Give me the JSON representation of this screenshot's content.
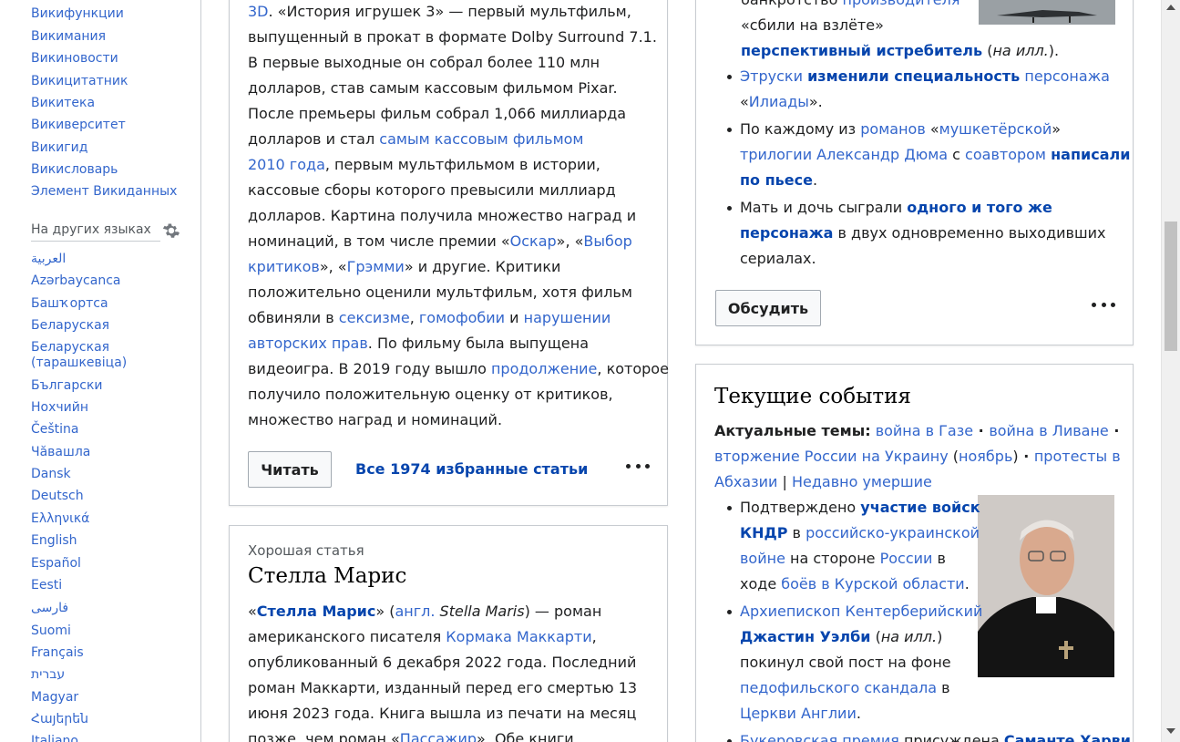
{
  "sidebar": {
    "projects": [
      "Викифункции",
      "Викимания",
      "Викиновости",
      "Викицитатник",
      "Викитека",
      "Викиверситет",
      "Викигид",
      "Викисловарь",
      "Элемент Викиданных"
    ],
    "languages_heading": "На других языках",
    "languages": [
      "العربية",
      "Azərbaycanca",
      "Башҡортса",
      "Беларуская",
      "Беларуская",
      "(тарашкевіца)",
      "Български",
      "Нохчийн",
      "Čeština",
      "Чӑвашла",
      "Dansk",
      "Deutsch",
      "Ελληνικά",
      "English",
      "Español",
      "Eesti",
      "فارسی",
      "Suomi",
      "Français",
      "עברית",
      "Magyar",
      "Հայերեն",
      "Italiano"
    ]
  },
  "featured": {
    "l1a": "3D",
    "l1b": ". «История игрушек 3» — первый мультфильм,",
    "l2": "выпущенный в прокат в формате Dolby Surround 7.1.",
    "l3": "В первые выходные он собрал более 110 млн",
    "l4": "долларов, став самым кассовым фильмом Pixar.",
    "l5": "После премьеры фильм собрал 1,066 миллиарда",
    "l6a": "долларов и стал ",
    "l6b": "самым кассовым фильмом",
    "l7a": "2010 года",
    "l7b": ", первым мультфильмом в истории,",
    "l8": "кассовые сборы которого превысили миллиард",
    "l9": "долларов. Картина получила множество наград и",
    "l10a": "номинаций, в том числе премии «",
    "l10b": "Оскар",
    "l10c": "», «",
    "l10d": "Выбор",
    "l11a": "критиков",
    "l11b": "», «",
    "l11c": "Грэмми",
    "l11d": "» и другие. Критики",
    "l12": "положительно оценили мультфильм, хотя фильм",
    "l13a": "обвиняли в ",
    "l13b": "сексизме",
    "l13c": ", ",
    "l13d": "гомофобии",
    "l13e": " и ",
    "l13f": "нарушении",
    "l14a": "авторских прав",
    "l14b": ". По фильму была выпущена",
    "l15a": "видеоигра. В 2019 году вышло ",
    "l15b": "продолжение",
    "l15c": ", которое",
    "l16": "получило положительную оценку от критиков,",
    "l17": "множество наград и номинаций.",
    "read_button": "Читать",
    "all_link": "Все 1974 избранные статьи"
  },
  "good": {
    "label": "Хорошая статья",
    "title": "Стелла Марис",
    "l1a": "«",
    "l1b": "Стелла Марис",
    "l1c": "» (",
    "l1d": "англ.",
    "l1e": " ",
    "l1f": "Stella Maris",
    "l1g": ") — роман",
    "l2a": "американского писателя ",
    "l2b": "Кормака Маккарти",
    "l2c": ",",
    "l3": "опубликованный 6 декабря 2022 года. Последний",
    "l4": "роман Маккарти, изданный перед его смертью 13",
    "l5": "июня 2023 года. Книга вышла из печати на месяц",
    "l6a": "позже, чем роман «",
    "l6b": "Пассажир",
    "l6c": "». Обе книги"
  },
  "facts": {
    "top1a": "банкротство ",
    "top1b": "производителя",
    "top2": "«сбили на взлёте»",
    "top3a": "перспективный истребитель",
    "top3b": " (",
    "top3c": "на илл.",
    "top3d": ").",
    "b1a": "Этруски",
    "b1b": " ",
    "b1c": "изменили специальность",
    "b1d": " персонажа",
    "b1e": "«",
    "b1f": "Илиады",
    "b1g": "».",
    "b2a": "По каждому из ",
    "b2b": "романов",
    "b2c": " «",
    "b2d": "мушкетёрской",
    "b2e": "»",
    "b2f": "трилогии Александр Дюма",
    "b2g": " с ",
    "b2h": "соавтором",
    "b2i": " ",
    "b2j": "написали",
    "b2k": "по пьесе",
    "b2l": ".",
    "b3a": "Мать и дочь сыграли ",
    "b3b": "одного и того же",
    "b3c": "персонажа",
    "b3d": " в двух одновременно выходивших",
    "b3e": "сериалах.",
    "discuss_button": "Обсудить"
  },
  "news": {
    "title": "Текущие события",
    "topics_label": "Актуальные темы:",
    "t1": "война в Газе",
    "sep": " · ",
    "t2": "война в Ливане",
    "t3": "вторжение России на Украину",
    "t3b": " (",
    "t3c": "ноябрь",
    "t3d": ")",
    "t4": "протесты в",
    "t5": "Абхазии",
    "bar": " | ",
    "t6": "Недавно умершие",
    "n1a": "Подтверждено ",
    "n1b": "участие войск",
    "n1c": "КНДР",
    "n1d": " в ",
    "n1e": "российско-украинской",
    "n1f": "войне",
    "n1g": " на стороне ",
    "n1h": "России",
    "n1i": " в",
    "n1j": "ходе ",
    "n1k": "боёв в Курской области",
    "n1l": ".",
    "n2a": "Архиепископ Кентерберийский",
    "n2b": "Джастин Уэлби",
    "n2c": " (",
    "n2d": "на илл.",
    "n2e": ")",
    "n2f": "покинул свой пост на фоне",
    "n2g": "педофильского скандала",
    "n2h": " в",
    "n2i": "Церкви Англии",
    "n2j": ".",
    "n3a": "Букеровская премия",
    "n3b": " присуждена ",
    "n3c": "Саманте Харви"
  },
  "icons": {
    "gear": "gear-icon",
    "more": "ellipsis-icon"
  },
  "colors": {
    "link": "#3366cc",
    "text": "#202122",
    "border": "#c8ccd1"
  }
}
